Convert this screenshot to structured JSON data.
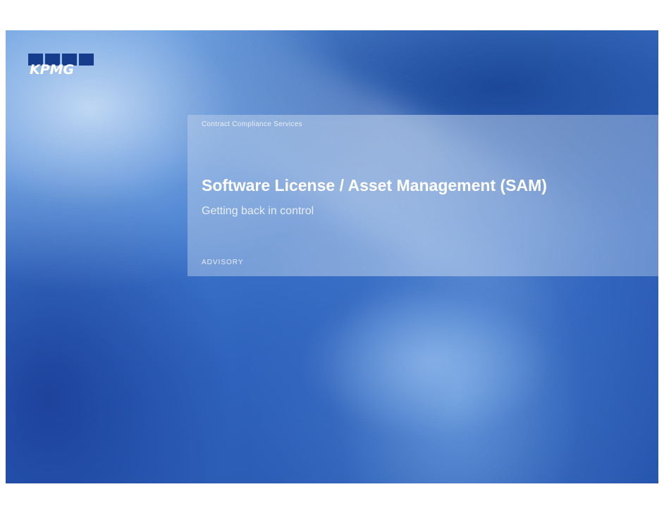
{
  "logo": {
    "text": "KPMG",
    "color": "#163d8c"
  },
  "header": {
    "kicker": "Contract Compliance Services"
  },
  "slide": {
    "title": "Software License / Asset Management (SAM)",
    "subtitle": "Getting back in control",
    "practice": "ADVISORY"
  },
  "colors": {
    "background_blue": "#2f63bd",
    "panel": "#c8daf0",
    "text": "#ffffff"
  }
}
